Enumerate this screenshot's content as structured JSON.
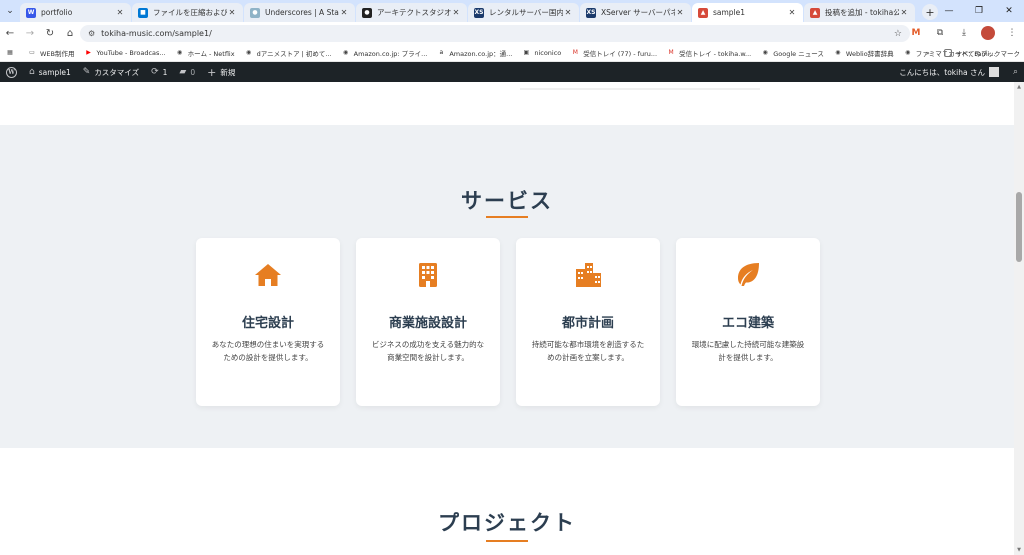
{
  "browser": {
    "tabs": [
      {
        "title": "portfolio",
        "icon": "wordpress-icon",
        "color": "#3858e9",
        "glyph": "W",
        "active": false
      },
      {
        "title": "ファイルを圧縮および展開する",
        "icon": "windows-icon",
        "color": "#0078d4",
        "glyph": "■",
        "active": false
      },
      {
        "title": "Underscores | A Starter Th",
        "icon": "underscores-icon",
        "color": "#8fb3c7",
        "glyph": "●",
        "active": false
      },
      {
        "title": "アーキテクトスタジオのデザイン",
        "icon": "github-icon",
        "color": "#222222",
        "glyph": "●",
        "active": false
      },
      {
        "title": "レンタルサーバー国内シェアNo",
        "icon": "xserver-icon",
        "color": "#1b3a6b",
        "glyph": "XS",
        "active": false
      },
      {
        "title": "XServer サーバーパネル",
        "icon": "xserver-icon",
        "color": "#1b3a6b",
        "glyph": "XS",
        "active": false
      },
      {
        "title": "sample1",
        "icon": "tokiha-icon",
        "color": "#d64a3a",
        "glyph": "▲",
        "active": true
      },
      {
        "title": "投稿を追加 - tokiha公式サ",
        "icon": "tokiha-icon",
        "color": "#d64a3a",
        "glyph": "▲",
        "active": false
      }
    ],
    "new_tab": "+",
    "window_controls": {
      "minimize": "—",
      "maximize": "❐",
      "close": "✕"
    },
    "url": "tokiha-music.com/sample1/",
    "bookmarks": [
      {
        "label": "",
        "icon": "apps-icon",
        "glyph": "▦",
        "color": "#555555"
      },
      {
        "label": "WEB制作用",
        "icon": "folder-icon",
        "glyph": "▭",
        "color": "#555555"
      },
      {
        "label": "YouTube - Broadcas...",
        "icon": "youtube-icon",
        "glyph": "▶",
        "color": "#ff0000"
      },
      {
        "label": "ホーム - Netflix",
        "icon": "globe-icon",
        "glyph": "◉",
        "color": "#444444"
      },
      {
        "label": "dアニメストア | 初めて...",
        "icon": "globe-icon",
        "glyph": "◉",
        "color": "#444444"
      },
      {
        "label": "Amazon.co.jp: プライ...",
        "icon": "globe-icon",
        "glyph": "◉",
        "color": "#444444"
      },
      {
        "label": "Amazon.co.jp：通...",
        "icon": "amazon-icon",
        "glyph": "a",
        "color": "#222222"
      },
      {
        "label": "niconico",
        "icon": "niconico-icon",
        "glyph": "▣",
        "color": "#444444"
      },
      {
        "label": "受信トレイ (77) - furu...",
        "icon": "gmail-icon",
        "glyph": "M",
        "color": "#d93025"
      },
      {
        "label": "受信トレイ - tokiha.w...",
        "icon": "gmail-icon",
        "glyph": "M",
        "color": "#d93025"
      },
      {
        "label": "Google ニュース",
        "icon": "globe-icon",
        "glyph": "◉",
        "color": "#444444"
      },
      {
        "label": "Weblio辞書辞典",
        "icon": "globe-icon",
        "glyph": "◉",
        "color": "#444444"
      },
      {
        "label": "ファミマＴカード：Fami...",
        "icon": "globe-icon",
        "glyph": "◉",
        "color": "#444444"
      }
    ],
    "bookmarks_more": "»",
    "all_bookmarks": "すべてのブックマーク"
  },
  "adminbar": {
    "site_name": "sample1",
    "customize": "カスタマイズ",
    "updates_count": "1",
    "comments_count": "0",
    "new_label": "新規",
    "greeting": "こんにちは、tokiha さん"
  },
  "services": {
    "title": "サービス",
    "accent_color": "#e67e22",
    "cards": [
      {
        "icon": "house-icon",
        "title": "住宅設計",
        "desc": "あなたの理想の住まいを実現するための設計を提供します。"
      },
      {
        "icon": "building-icon",
        "title": "商業施設設計",
        "desc": "ビジネスの成功を支える魅力的な商業空間を設計します。"
      },
      {
        "icon": "city-icon",
        "title": "都市計画",
        "desc": "持続可能な都市環境を創造するための計画を立案します。"
      },
      {
        "icon": "leaf-icon",
        "title": "エコ建築",
        "desc": "環境に配慮した持続可能な建築設計を提供します。"
      }
    ]
  },
  "projects": {
    "title": "プロジェクト"
  }
}
